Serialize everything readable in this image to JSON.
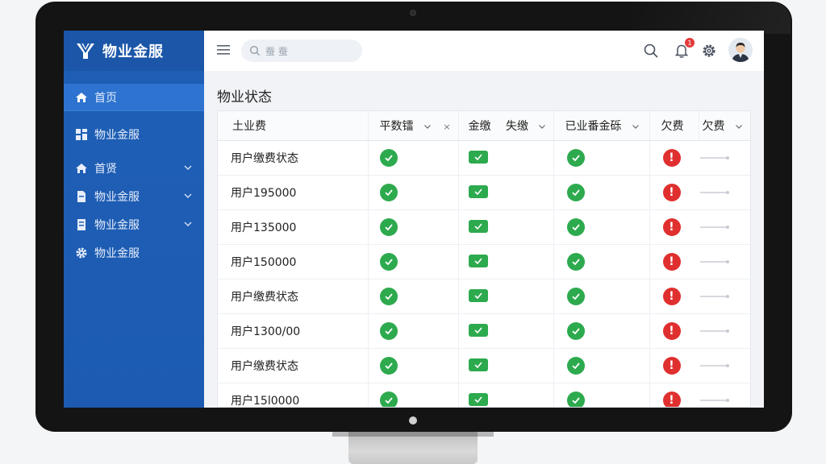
{
  "app": {
    "brand_name": "物业金服",
    "brand_color": "#1f5fb5"
  },
  "sidebar": {
    "items": [
      {
        "label": "首页",
        "icon": "home-icon",
        "active": true
      },
      {
        "label": "物业金服",
        "icon": "grid-icon"
      },
      {
        "label": "首贤",
        "icon": "home-icon",
        "expandable": true
      },
      {
        "label": "物业金服",
        "icon": "document-icon",
        "expandable": true
      },
      {
        "label": "物业金服",
        "icon": "document-icon",
        "expandable": true
      },
      {
        "label": "物业金服",
        "icon": "gear-icon"
      }
    ]
  },
  "topbar": {
    "search_text": "蚕 蚕",
    "notification_count": "1"
  },
  "main": {
    "title": "物业状态",
    "table": {
      "columns": [
        {
          "label": "土业费"
        },
        {
          "label": "平数镭",
          "chevron": true,
          "close": "×"
        },
        {
          "label": "金缴　 失缴",
          "chevron": true
        },
        {
          "label": "已业番金砾",
          "chevron": true
        },
        {
          "label": "欠费"
        },
        {
          "label": "欠费",
          "chevron": true
        }
      ],
      "rows": [
        {
          "name": "用户缴费状态",
          "s1": "ok",
          "s2": "ok",
          "s3": "ok",
          "s4": "warn"
        },
        {
          "name": "用户195000",
          "s1": "ok",
          "s2": "ok",
          "s3": "ok",
          "s4": "warn"
        },
        {
          "name": "用户135000",
          "s1": "ok",
          "s2": "ok",
          "s3": "ok",
          "s4": "warn"
        },
        {
          "name": "用户150000",
          "s1": "ok",
          "s2": "ok",
          "s3": "ok",
          "s4": "warn"
        },
        {
          "name": "用户缴费状态",
          "s1": "ok",
          "s2": "ok",
          "s3": "ok",
          "s4": "warn"
        },
        {
          "name": "用户1300/00",
          "s1": "ok",
          "s2": "ok",
          "s3": "ok",
          "s4": "warn"
        },
        {
          "name": "用户缴费状态",
          "s1": "ok",
          "s2": "ok",
          "s3": "ok",
          "s4": "warn"
        },
        {
          "name": "用户15l0000",
          "s1": "ok",
          "s2": "ok",
          "s3": "ok",
          "s4": "warn"
        }
      ]
    }
  },
  "colors": {
    "ok_green": "#2daa4e",
    "warn_red": "#e02f2f",
    "sidebar_blue": "#1f5fb5"
  }
}
